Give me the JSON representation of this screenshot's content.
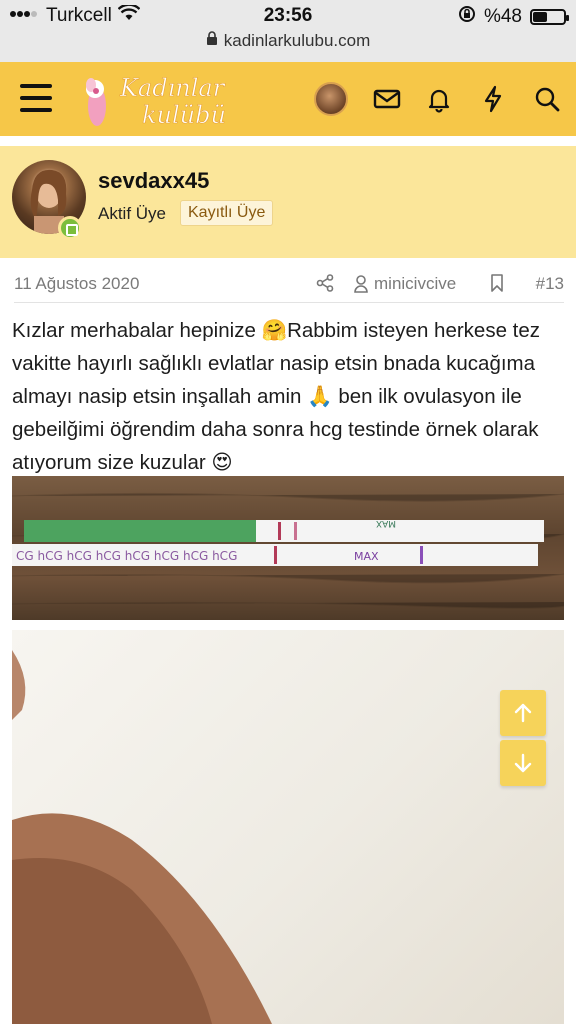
{
  "status_bar": {
    "carrier": "Turkcell",
    "time": "23:56",
    "battery": "%48",
    "battery_level": 0.48,
    "url": "kadinlarkulubu.com"
  },
  "header": {
    "logo_line1": "Kadınlar",
    "logo_line2": "kulübü",
    "icons": [
      "menu-icon",
      "avatar",
      "mail-icon",
      "bell-icon",
      "bolt-icon",
      "search-icon"
    ]
  },
  "profile": {
    "username": "sevdaxx45",
    "role": "Aktif Üye",
    "badge": "Kayıtlı Üye"
  },
  "post": {
    "date": "11 Ağustos 2020",
    "author": "minicivcive",
    "number": "#13",
    "text": "Kızlar merhabalar hepinize 🤗Rabbim isteyen herkese tez vakitte hayırlı sağlıklı evlatlar nasip etsin bnada kucağıma almayı nasip etsin inşallah amin 🙏 ben ilk ovulasyon ile gebeilğimi öğrendim daha sonra hcg testinde örnek olarak atıyorum size kuzular 😍"
  },
  "photo1": {
    "strip_top_text": "MAX",
    "strip_bottom_text": "MAX",
    "strip_bottom_repeat": "CG hCG hCG hCG hCG hCG hCG hCG"
  },
  "colors": {
    "accent": "#f6c748",
    "profile_bg": "#fbe69a",
    "scroll_button": "#f6d35a"
  }
}
